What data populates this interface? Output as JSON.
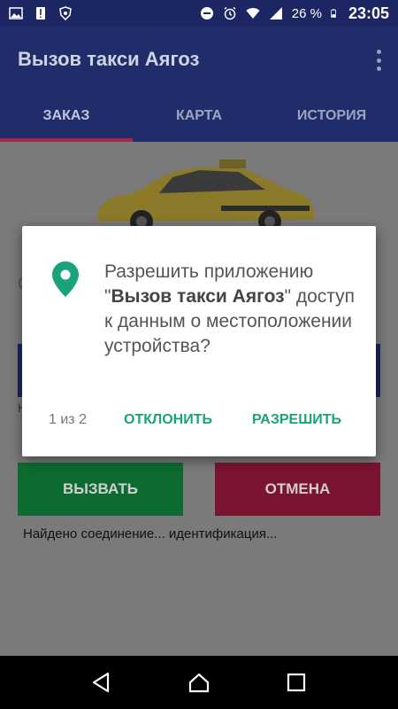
{
  "status_bar": {
    "battery": "26 %",
    "time": "23:05"
  },
  "app_bar": {
    "title": "Вызов такси Аягоз"
  },
  "tabs": [
    {
      "label": "ЗАКАЗ",
      "active": true
    },
    {
      "label": "КАРТА",
      "active": false
    },
    {
      "label": "ИСТОРИЯ",
      "active": false
    }
  ],
  "content": {
    "call_button": "ВЫЗВАТЬ",
    "cancel_button": "ОТМЕНА",
    "status_text": "Найдено соединение... идентификация...",
    "dim_left_text": "С",
    "dim_small_text": "Н"
  },
  "dialog": {
    "line_prefix": "Разрешить приложению \"",
    "app_name": "Вызов такси Аягоз",
    "line_suffix": "\" доступ к данным о местоположении устройства?",
    "counter": "1 из 2",
    "deny": "ОТКЛОНИТЬ",
    "allow": "РАЗРЕШИТЬ"
  },
  "colors": {
    "primary": "#202d6a",
    "accent": "#1aa37a",
    "call_green": "#0d6b32",
    "cancel_red": "#7a1430"
  }
}
